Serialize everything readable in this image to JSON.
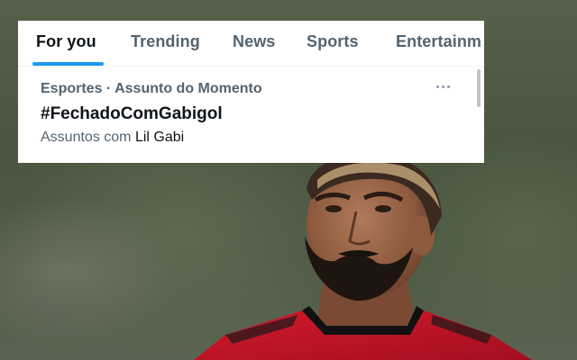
{
  "tabs": [
    {
      "label": "For you",
      "active": true
    },
    {
      "label": "Trending",
      "active": false
    },
    {
      "label": "News",
      "active": false
    },
    {
      "label": "Sports",
      "active": false
    },
    {
      "label": "Entertainm",
      "active": false
    }
  ],
  "trend": {
    "meta": "Esportes · Assunto do Momento",
    "title": "#FechadoComGabigol",
    "related_prefix": "Assuntos com",
    "related_name": "Lil Gabi",
    "more_icon": "more-horizontal-icon"
  },
  "colors": {
    "accent": "#1d9bf0",
    "text_primary": "#0f1419",
    "text_secondary": "#536471",
    "jersey_red": "#c8102e",
    "jersey_black": "#111111"
  }
}
